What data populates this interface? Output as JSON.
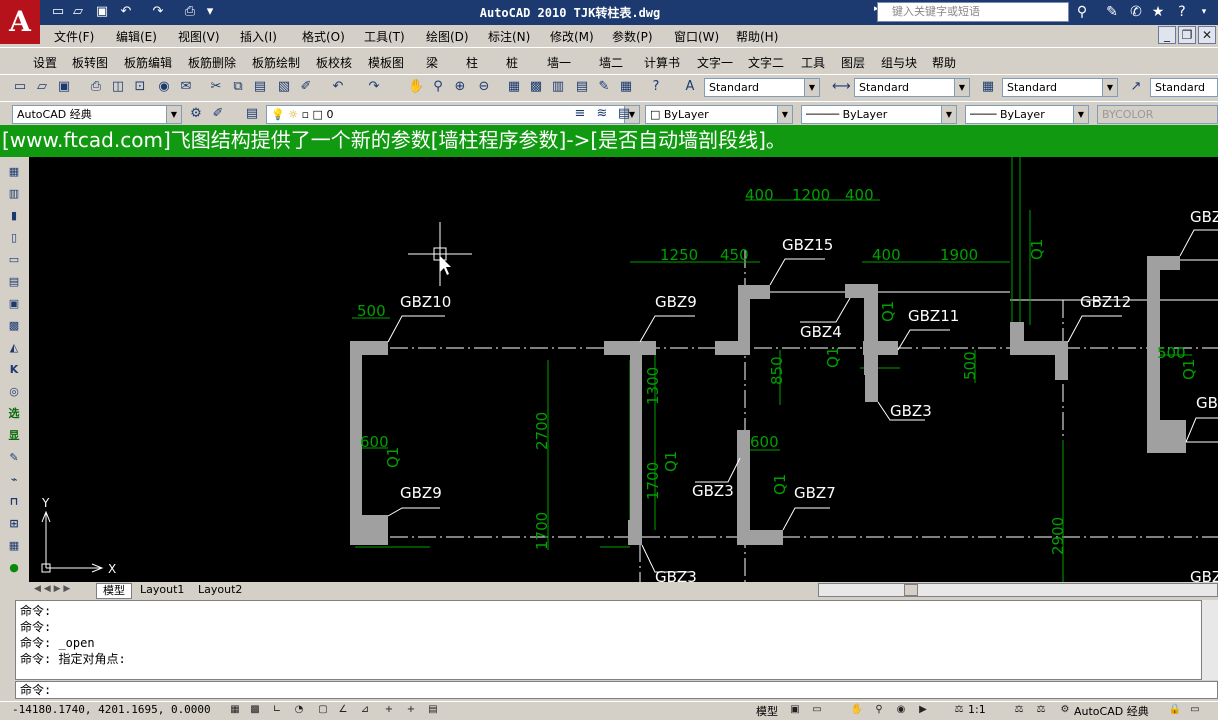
{
  "app": {
    "logo_letter": "A",
    "title": "AutoCAD 2010   TJK转柱表.dwg"
  },
  "search": {
    "placeholder": "键入关键字或短语"
  },
  "menus": [
    "文件(F)",
    "编辑(E)",
    "视图(V)",
    "插入(I)",
    "格式(O)",
    "工具(T)",
    "绘图(D)",
    "标注(N)",
    "修改(M)",
    "参数(P)",
    "窗口(W)",
    "帮助(H)"
  ],
  "custom_menus": [
    "设置",
    "板转图",
    "板筋编辑",
    "板筋删除",
    "板筋绘制",
    "板校核",
    "模板图",
    "梁",
    "柱",
    "桩",
    "墙一",
    "墙二",
    "计算书",
    "文字一",
    "文字二",
    "工具",
    "图层",
    "组与块",
    "帮助"
  ],
  "workspace": {
    "value": "AutoCAD 经典"
  },
  "layer": {
    "value": "0"
  },
  "text_style": {
    "value": "Standard"
  },
  "dim_style": {
    "value": "Standard"
  },
  "table_style": {
    "value": "Standard"
  },
  "mleader_style": {
    "value": "Standard"
  },
  "properties": {
    "color": "ByLayer",
    "linetype": "ByLayer",
    "lineweight": "ByLayer",
    "plotstyle": "BYCOLOR"
  },
  "banner": {
    "text": "[www.ftcad.com]飞图结构提供了一个新的参数[墙柱程序参数]->[是否自动墙剖段线]。",
    "color": "#119a11"
  },
  "left_toolbar_icons": [
    "rect-icon",
    "table-icon",
    "wall-icon",
    "column-icon",
    "beam-icon",
    "stair-icon",
    "door-icon",
    "grid-icon",
    "section-icon",
    "text-icon",
    "snap-icon",
    "select-icon",
    "elevation-icon",
    "pencil-icon",
    "bolt-icon",
    "pipe-icon",
    "frame-icon",
    "user-icon"
  ],
  "left_toolbar_labels": [
    "",
    "",
    "",
    "",
    "",
    "",
    "",
    "",
    "",
    "",
    "",
    "选",
    "显",
    "",
    "",
    "",
    "",
    ""
  ],
  "drawing": {
    "labels": [
      "GBZ15",
      "GBZ10",
      "GBZ9",
      "GBZ4",
      "GBZ11",
      "GBZ12",
      "GBZ3",
      "GBZ9",
      "GBZ3",
      "GBZ7",
      "GBZ3",
      "GBZ",
      "GBZ",
      "GBZ"
    ],
    "dims": [
      "400",
      "1200",
      "400",
      "1250",
      "450",
      "400",
      "1900",
      "500",
      "850",
      "500",
      "500",
      "600",
      "600",
      "2700",
      "1300",
      "1700",
      "1700",
      "2900",
      "Q1",
      "Q1",
      "Q1",
      "Q1",
      "Q1",
      "Q1",
      "Q1"
    ],
    "ucs": {
      "x": "X",
      "y": "Y"
    },
    "colors": {
      "background": "#000000",
      "column_fill": "#a0a0a0",
      "dim": "#00a000",
      "line": "#ffffff"
    }
  },
  "tabs": [
    "模型",
    "Layout1",
    "Layout2"
  ],
  "command": {
    "history": [
      "命令:",
      "命令:",
      "命令: _open",
      "命令: 指定对角点:"
    ],
    "prompt": "命令:"
  },
  "status": {
    "coords": "-14180.1740, 4201.1695, 0.0000",
    "model": "模型",
    "scale": "1:1",
    "workspace": "AutoCAD 经典"
  }
}
